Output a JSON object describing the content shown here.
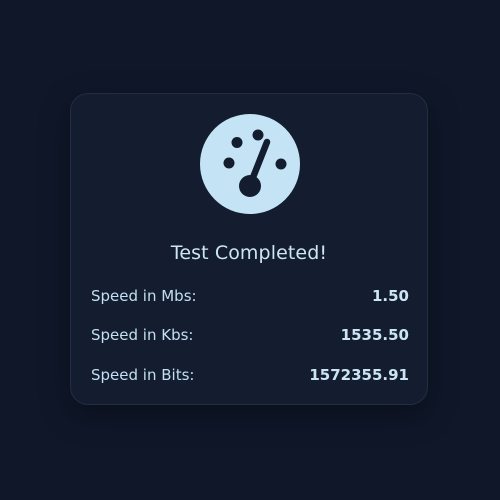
{
  "result": {
    "title": "Test Completed!",
    "icon": "speedometer-icon",
    "rows": [
      {
        "label": "Speed in Mbs:",
        "value": "1.50"
      },
      {
        "label": "Speed in Kbs:",
        "value": "1535.50"
      },
      {
        "label": "Speed in Bits:",
        "value": "1572355.91"
      }
    ]
  },
  "colors": {
    "background": "#0f1729",
    "card": "#141d30",
    "accent": "#c4e4f6",
    "text": "#c3dff3"
  }
}
